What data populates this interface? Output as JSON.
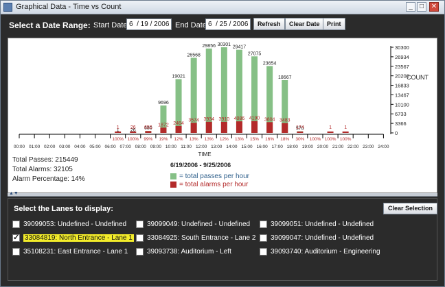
{
  "window": {
    "title": "Graphical Data - Time vs Count"
  },
  "toolbar": {
    "range_label": "Select a Date Range:",
    "start_label": "Start Date",
    "start_value": "6  / 19 / 2006",
    "end_label": "End Date",
    "end_value": "6  / 25 / 2006",
    "refresh_label": "Refresh",
    "clear_date_label": "Clear Date",
    "print_label": "Print"
  },
  "summary": {
    "passes": "Total Passes: 215449",
    "alarms": "Total Alarms: 32105",
    "percentage": "Alarm Percentage: 14%"
  },
  "chart_data": {
    "type": "bar",
    "xlabel": "TIME",
    "ylabel": "COUNT",
    "ylim": [
      0,
      30300
    ],
    "y_ticks": [
      "30300",
      "26934",
      "23567",
      "20200",
      "16833",
      "13467",
      "10100",
      "6733",
      "3366",
      "0"
    ],
    "categories": [
      "00:00",
      "01:00",
      "02:00",
      "03:00",
      "04:00",
      "05:00",
      "06:00",
      "07:00",
      "08:00",
      "09:00",
      "10:00",
      "11:00",
      "12:00",
      "13:00",
      "14:00",
      "15:00",
      "16:00",
      "17:00",
      "18:00",
      "19:00",
      "20:00",
      "21:00",
      "22:00",
      "23:00"
    ],
    "last_tick": "24:00",
    "series": [
      {
        "name": "total passes per hour",
        "color": "#86c086",
        "values": [
          0,
          0,
          0,
          0,
          0,
          0,
          1,
          26,
          680,
          9696,
          19021,
          26568,
          29856,
          30301,
          29417,
          27075,
          23654,
          18667,
          578,
          0,
          0,
          0,
          0,
          0
        ]
      },
      {
        "name": "total alarms per hour",
        "color": "#b32a2a",
        "values": [
          0,
          0,
          0,
          0,
          0,
          0,
          1,
          26,
          656,
          1872,
          2464,
          3574,
          3934,
          3910,
          4086,
          4190,
          3804,
          3483,
          174,
          0,
          1,
          1,
          0,
          0
        ]
      }
    ],
    "pass_labels": [
      "",
      "",
      "",
      "",
      "",
      "",
      "1",
      "26",
      "680",
      "9696",
      "19021",
      "26568",
      "29856",
      "30301",
      "29417",
      "27075",
      "23654",
      "18667",
      "578",
      "",
      "",
      "",
      "",
      ""
    ],
    "alarm_labels": [
      "",
      "",
      "",
      "",
      "",
      "",
      "1",
      "26",
      "656",
      "1872",
      "2464",
      "3574",
      "3934",
      "3910",
      "4086",
      "4190",
      "3804",
      "3483",
      "174",
      "",
      "1",
      "1",
      "",
      ""
    ],
    "pct_labels": [
      "",
      "",
      "",
      "",
      "",
      "",
      "100%",
      "100%",
      "99%",
      "19%",
      "12%",
      "13%",
      "13%",
      "12%",
      "13%",
      "15%",
      "16%",
      "18%",
      "30%",
      "100%",
      "100%",
      "100%",
      "",
      ""
    ],
    "date_range": "6/19/2006 - 9/25/2006"
  },
  "lanes": {
    "title": "Select the Lanes to display:",
    "clear_label": "Clear Selection",
    "items": [
      {
        "label": "39099053:  Undefined -  Undefined",
        "checked": false,
        "selected": false
      },
      {
        "label": "39099049:  Undefined -  Undefined",
        "checked": false,
        "selected": false
      },
      {
        "label": "39099051:  Undefined -  Undefined",
        "checked": false,
        "selected": false
      },
      {
        "label": "33084819: North Entrance - Lane 1",
        "checked": true,
        "selected": true
      },
      {
        "label": "33084925: South Entrance - Lane 2",
        "checked": false,
        "selected": false
      },
      {
        "label": "39099047:  Undefined -  Undefined",
        "checked": false,
        "selected": false
      },
      {
        "label": "35108231: East Entrance - Lane 1",
        "checked": false,
        "selected": false
      },
      {
        "label": "39093738:   Auditorium -    Left",
        "checked": false,
        "selected": false
      },
      {
        "label": "39093740:   Auditorium -   Engineering",
        "checked": false,
        "selected": false
      }
    ]
  }
}
